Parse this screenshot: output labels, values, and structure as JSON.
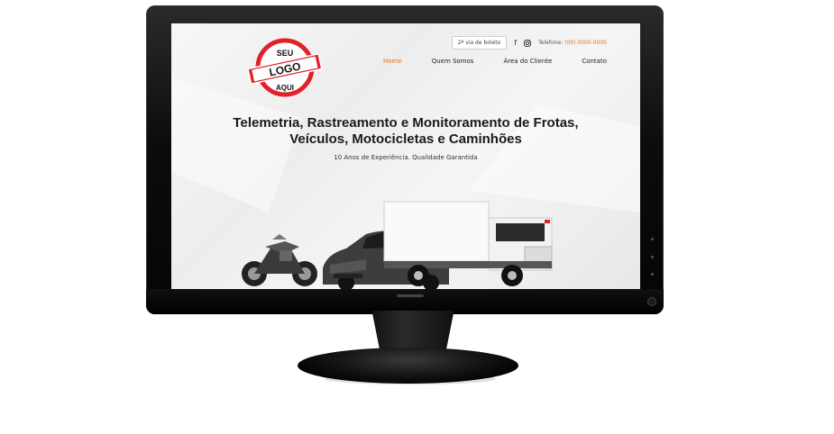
{
  "site": {
    "logo_top": "SEU",
    "logo_main": "LOGO",
    "logo_bottom": "AQUI",
    "boleto_button": "2ª via de boleto",
    "social_icons": [
      "facebook-icon",
      "instagram-icon"
    ],
    "phone_label": "Telefone:",
    "phone_number": "(00) 0000-0000",
    "nav": [
      {
        "label": "Home",
        "active": true
      },
      {
        "label": "Quem Somos",
        "active": false
      },
      {
        "label": "Área do Cliente",
        "active": false
      },
      {
        "label": "Contato",
        "active": false
      }
    ],
    "headline_line1": "Telemetria, Rastreamento e Monitoramento de Frotas,",
    "headline_line2": "Veículos, Motocicletas e Caminhões",
    "tagline": "10 Anos de Experiência. Qualidade Garantida"
  },
  "colors": {
    "accent": "#e0751b",
    "logo_red": "#e0202a",
    "monitor_black": "#0a0a0a"
  }
}
